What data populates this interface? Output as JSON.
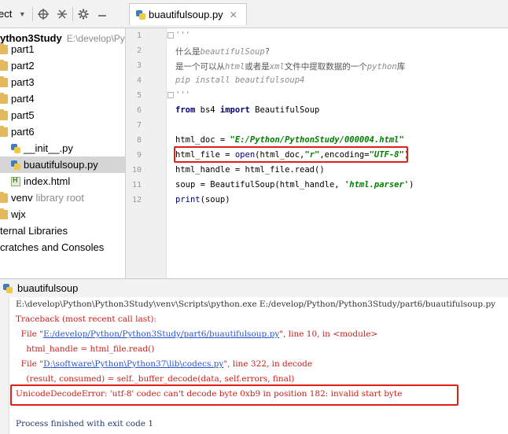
{
  "project_toolbar": {
    "label": "ect",
    "dropdown_icon": "triangle-down",
    "icons": [
      "crosshair",
      "collapse",
      "gear",
      "hide"
    ]
  },
  "project_tree": {
    "root": {
      "name": "ython3Study",
      "path": "E:\\develop\\Py"
    },
    "items": [
      {
        "label": "part1"
      },
      {
        "label": "part2"
      },
      {
        "label": "part3"
      },
      {
        "label": "part4"
      },
      {
        "label": "part5"
      },
      {
        "label": "part6"
      },
      {
        "label": "__init__.py"
      },
      {
        "label": "buautifulsoup.py"
      },
      {
        "label": "index.html"
      },
      {
        "label": "venv",
        "suffix": "library root"
      },
      {
        "label": "wjx"
      },
      {
        "label": "ternal Libraries"
      },
      {
        "label": "cratches and Consoles"
      }
    ]
  },
  "editor": {
    "tab_label": "buautifulsoup.py",
    "line_numbers": [
      "1",
      "2",
      "3",
      "4",
      "5",
      "6",
      "7",
      "8",
      "9",
      "10",
      "11",
      "12"
    ],
    "code": {
      "l1": "'''",
      "l2_a": "什么是",
      "l2_b": "beautifulSoup",
      "l2_c": "?",
      "l3_a": "是一个可以从",
      "l3_b": "html",
      "l3_c": "或者是",
      "l3_d": "xml",
      "l3_e": "文件中提取数据的一个",
      "l3_f": "python",
      "l3_g": "库",
      "l4": "pip install beautifulsoup4",
      "l5": "'''",
      "l6_kw1": "from",
      "l6_mod": " bs4 ",
      "l6_kw2": "import",
      "l6_name": " BeautifulSoup",
      "l8_a": "html_doc = ",
      "l8_str": "\"E:/Python/PythonStudy/000004.html\"",
      "l9_a": "html_file = ",
      "l9_fn": "open",
      "l9_b": "(html_doc,",
      "l9_str1": "\"r\"",
      "l9_c": ",encoding=",
      "l9_str2": "\"UTF-8\"",
      "l9_d": ")",
      "l10": "html_handle = html_file.read()",
      "l11_a": "soup = BeautifulSoup(html_handle, ",
      "l11_str": "'html.parser'",
      "l11_b": ")",
      "l12_fn": "print",
      "l12_b": "(soup)"
    }
  },
  "run_panel": {
    "tab_label": "buautifulsoup",
    "lines": {
      "cmd": "E:\\develop\\Python\\Python3Study\\venv\\Scripts\\python.exe E:/develop/Python/Python3Study/part6/buautifulsoup.py",
      "traceback": "Traceback (most recent call last):",
      "file1_pre": "  File \"",
      "file1_link": "E:/develop/Python/Python3Study/part6/buautifulsoup.py",
      "file1_post": "\", line 10, in <module>",
      "code1": "    html_handle = html_file.read()",
      "file2_pre": "  File \"",
      "file2_link": "D:\\software\\Python\\Python37\\lib\\codecs.py",
      "file2_post": "\", line 322, in decode",
      "code2": "    (result, consumed) = self._buffer_decode(data, self.errors, final)",
      "error": "UnicodeDecodeError: 'utf-8' codec can't decode byte 0xb9 in position 182: invalid start byte",
      "exit": "Process finished with exit code 1"
    }
  }
}
